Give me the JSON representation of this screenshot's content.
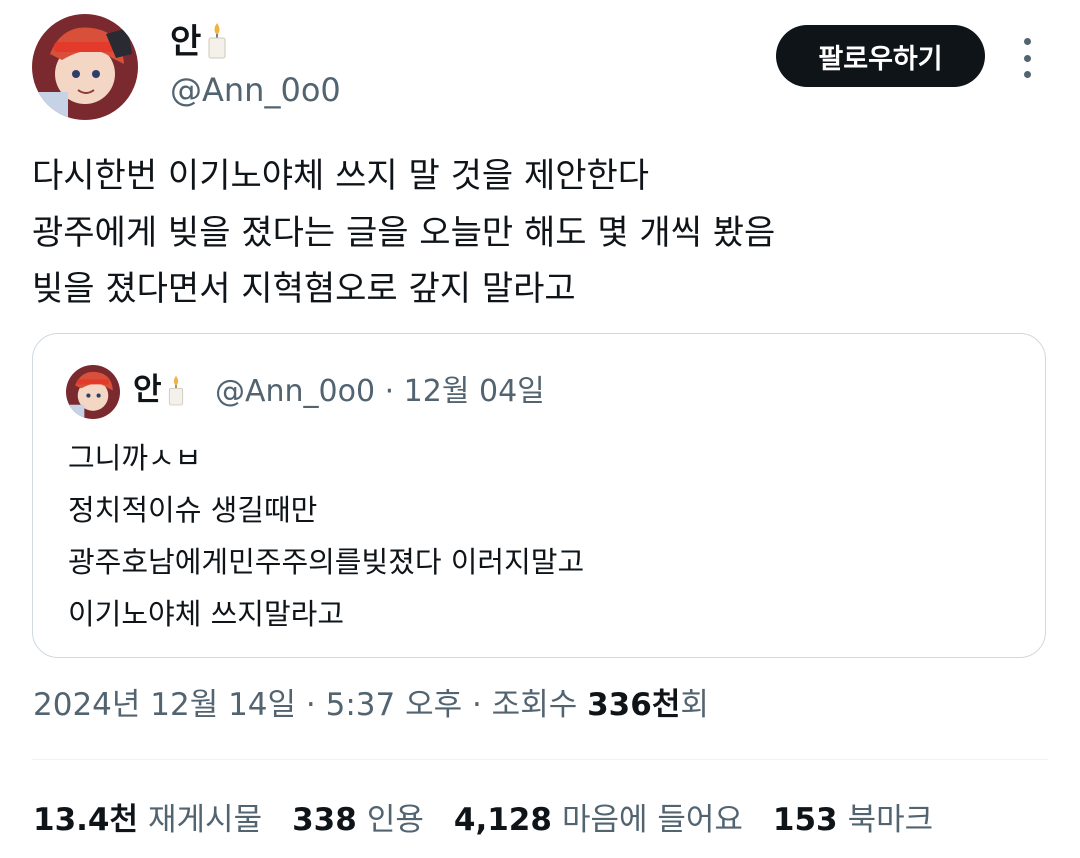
{
  "author": {
    "display_name": "안",
    "handle": "@Ann_0o0",
    "name_emoji": "candle"
  },
  "header": {
    "follow_label": "팔로우하기",
    "more_icon": "more-vertical-icon"
  },
  "tweet": {
    "lines": [
      "다시한번 이기노야체 쓰지 말 것을 제안한다",
      "광주에게 빚을 졌다는 글을 오늘만 해도 몇 개씩 봤음",
      "빚을 졌다면서 지혁혐오로 갚지 말라고"
    ]
  },
  "quote": {
    "display_name": "안",
    "handle_date": "@Ann_0o0 · 12월 04일",
    "lines": [
      "그니까ㅅㅂ",
      "정치적이슈 생길때만",
      "광주호남에게민주주의를빚졌다 이러지말고",
      "이기노야체 쓰지말라고"
    ]
  },
  "meta": {
    "date_time": "2024년 12월 14일 · 5:37 오후 · 조회수 ",
    "views_num": "336천",
    "views_suffix": "회"
  },
  "stats": {
    "reposts_num": "13.4천",
    "reposts_label": "재게시물",
    "quotes_num": "338",
    "quotes_label": "인용",
    "likes_num": "4,128",
    "likes_label": "마음에 들어요",
    "bookmarks_num": "153",
    "bookmarks_label": "북마크"
  },
  "colors": {
    "text_primary": "#0f1419",
    "text_secondary": "#536471",
    "border": "#cfd9de",
    "avatar_bg": "#8b2c2c",
    "avatar_hair": "#d8503a"
  }
}
